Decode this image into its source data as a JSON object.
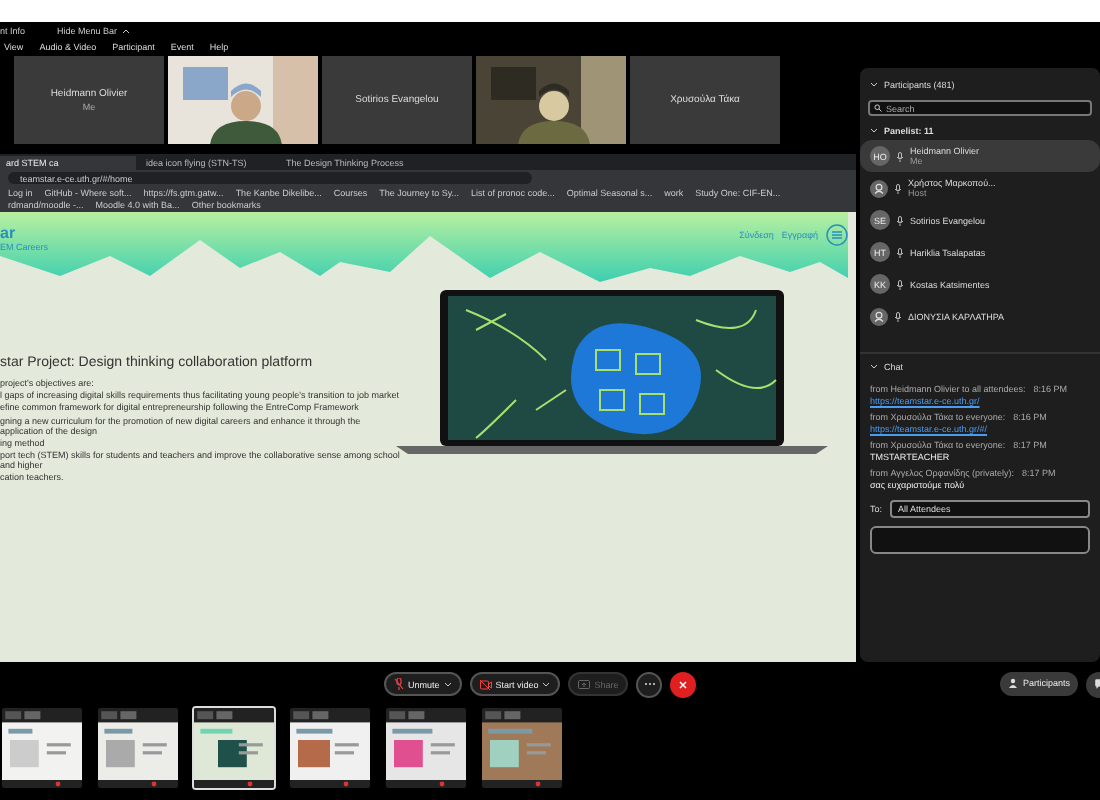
{
  "top_bar": {
    "info": "nt Info",
    "hide_menu": "Hide Menu Bar"
  },
  "menu": [
    "View",
    "Audio & Video",
    "Participant",
    "Event",
    "Help"
  ],
  "video_tiles": [
    {
      "kind": "name",
      "name": "Heidmann Olivier",
      "note": "Me"
    },
    {
      "kind": "picture"
    },
    {
      "kind": "name",
      "name": "Sotirios Evangelou"
    },
    {
      "kind": "picture"
    },
    {
      "kind": "name",
      "name": "Χρυσούλα Τάκα"
    }
  ],
  "browser": {
    "tabs": [
      {
        "title": "ard STEM ca",
        "selected": true
      },
      {
        "title": "idea icon flying (STN-TS)",
        "selected": false
      },
      {
        "title": "The Design Thinking Process",
        "selected": false
      }
    ],
    "address": "teamstar.e-ce.uth.gr/#/home",
    "bookmarks": [
      "Log in",
      "GitHub - Where soft...",
      "https://fs.gtm.gatw...",
      "The Kanbe Dikelibe...",
      "Courses",
      "The Journey to Sy...",
      "List of pronoc code...",
      "Optimal Seasonal s...",
      "work",
      "Study One: CIF-EN...",
      "rdmand/moodle -...",
      "Moodle 4.0 with Ba...",
      "Other bookmarks"
    ]
  },
  "page": {
    "logo": "ar",
    "logo_sub": "EM Careers",
    "links": [
      "Σύνδεση",
      "Εγγραφή"
    ],
    "heading": "star Project: Design thinking collaboration platform",
    "lines": [
      "project's objectives are:",
      "l gaps of increasing digital skills requirements thus facilitating young people's transition to job market",
      "efine common framework for digital entrepreneurship following the EntreComp Framework",
      "gning a new curriculum for the promotion of new digital careers and enhance it through the application of the design",
      "ing method",
      "port tech (STEM) skills for students and teachers and improve the collaborative sense among school and higher",
      "cation teachers."
    ]
  },
  "controls": [
    {
      "kind": "mic",
      "label": "Unmute",
      "disabled": false
    },
    {
      "kind": "video",
      "label": "Start video",
      "disabled": false
    },
    {
      "kind": "share",
      "label": "Share",
      "disabled": true
    },
    {
      "kind": "more"
    },
    {
      "kind": "leave"
    }
  ],
  "side_buttons": [
    {
      "kind": "participants",
      "label": "Participants"
    },
    {
      "kind": "chat"
    }
  ],
  "participants": {
    "title": "Participants (481)",
    "placeholder": "Search",
    "group": "Panelist: 11",
    "items": [
      {
        "name": "Heidmann Olivier",
        "role": "Me",
        "kind": "initials",
        "initials": "HO",
        "selected": true
      },
      {
        "name": "Χρήστος Μαρκοπού...",
        "role": "Host",
        "kind": "person",
        "selected": false
      },
      {
        "name": "Sotirios Evangelou",
        "kind": "initials",
        "initials": "SE",
        "selected": false
      },
      {
        "name": "Hariklia Tsalapatas",
        "kind": "initials",
        "initials": "HT",
        "selected": false
      },
      {
        "name": "Kostas Katsimentes",
        "kind": "initials",
        "initials": "KK",
        "selected": false
      },
      {
        "name": "ΔΙΟΝΥΣΙΑ ΚΑΡΛΑΤΗΡΑ",
        "kind": "person",
        "selected": false
      }
    ]
  },
  "chat": {
    "title": "Chat",
    "messages": [
      {
        "sender": "from Heidmann Olivier to all attendees:",
        "time": "8:16 PM",
        "text": "https://teamstar.e-ce.uth.gr/",
        "kind": "link"
      },
      {
        "sender": "from Χρυσούλα Τάκα to everyone:",
        "time": "8:16 PM",
        "text": "https://teamstar.e-ce.uth.gr/#/",
        "kind": "link"
      },
      {
        "sender": "from Χρυσούλα Τάκα to everyone:",
        "time": "8:17 PM",
        "text": "TMSTARTEACHER",
        "kind": "text"
      },
      {
        "sender": "from Αγγελος Ορφανίδης (privately):",
        "time": "8:17 PM",
        "text": "σας ευχαριστούμε πολύ",
        "kind": "text"
      }
    ],
    "to_label": "To:",
    "to_value": "All Attendees"
  },
  "thumbnails": [
    {
      "selected": false
    },
    {
      "selected": false
    },
    {
      "selected": true
    },
    {
      "selected": false
    },
    {
      "selected": false
    },
    {
      "selected": false
    }
  ]
}
